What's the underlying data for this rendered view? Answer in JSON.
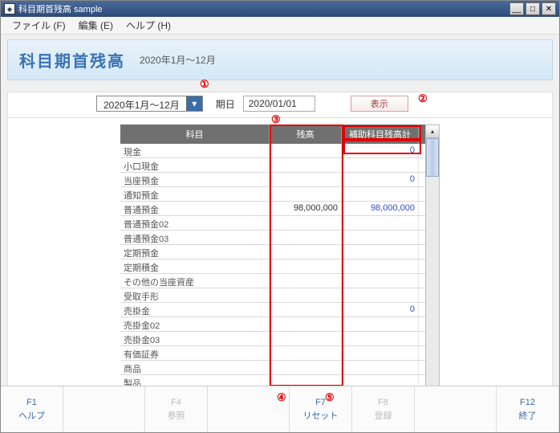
{
  "window": {
    "title": "科目期首残高 sample"
  },
  "menus": {
    "file": "ファイル (F)",
    "edit": "編集 (E)",
    "help": "ヘルプ (H)"
  },
  "header": {
    "title": "科目期首残高",
    "sub": "2020年1月～12月"
  },
  "filter": {
    "period": "2020年1月～12月",
    "date_label": "期日",
    "date": "2020/01/01",
    "show": "表示"
  },
  "annots": {
    "a1": "①",
    "a2": "②",
    "a3": "③",
    "a4": "④",
    "a5": "⑤"
  },
  "table": {
    "headers": {
      "c1": "科目",
      "c2": "残高",
      "c3": "補助科目残高計"
    },
    "rows": [
      {
        "name": "現金",
        "bal": "",
        "sub": "0"
      },
      {
        "name": "小口現金",
        "bal": "",
        "sub": ""
      },
      {
        "name": "当座預金",
        "bal": "",
        "sub": "0"
      },
      {
        "name": "通知預金",
        "bal": "",
        "sub": ""
      },
      {
        "name": "普通預金",
        "bal": "98,000,000",
        "sub": "98,000,000"
      },
      {
        "name": "普通預金02",
        "bal": "",
        "sub": ""
      },
      {
        "name": "普通預金03",
        "bal": "",
        "sub": ""
      },
      {
        "name": "定期預金",
        "bal": "",
        "sub": ""
      },
      {
        "name": "定期積金",
        "bal": "",
        "sub": ""
      },
      {
        "name": "その他の当座資産",
        "bal": "",
        "sub": ""
      },
      {
        "name": "受取手形",
        "bal": "",
        "sub": ""
      },
      {
        "name": "売掛金",
        "bal": "",
        "sub": "0"
      },
      {
        "name": "売掛金02",
        "bal": "",
        "sub": ""
      },
      {
        "name": "売掛金03",
        "bal": "",
        "sub": ""
      },
      {
        "name": "有価証券",
        "bal": "",
        "sub": ""
      },
      {
        "name": "商品",
        "bal": "",
        "sub": ""
      },
      {
        "name": "製品",
        "bal": "",
        "sub": ""
      }
    ]
  },
  "fkeys": {
    "f1": {
      "num": "F1",
      "label": "ヘルプ"
    },
    "f4": {
      "num": "F4",
      "label": "参照"
    },
    "f7": {
      "num": "F7",
      "label": "リセット"
    },
    "f8": {
      "num": "F8",
      "label": "登録"
    },
    "f12": {
      "num": "F12",
      "label": "終了"
    }
  }
}
